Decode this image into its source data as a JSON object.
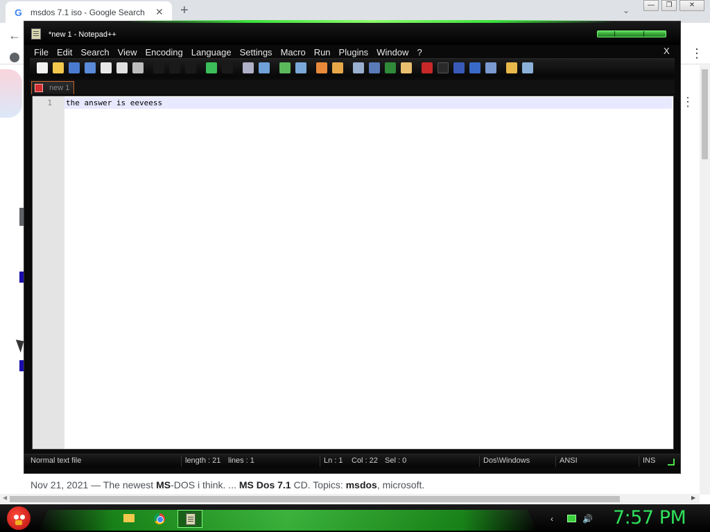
{
  "browser": {
    "tab_title": "msdos 7.1 iso - Google Search",
    "tab_favicon": "G",
    "tab_close": "✕",
    "new_tab": "+",
    "tab_search": "⌄",
    "win_minimize": "—",
    "win_restore": "❐",
    "win_close": "✕",
    "back": "←",
    "menu": "⋮",
    "result_snippet": {
      "date": "Nov 21, 2021 — The newest ",
      "b1": "MS",
      "t1": "-DOS i think. ... ",
      "b2": "MS Dos 7.1",
      "t2": " CD. Topics: ",
      "b3": "msdos",
      "t3": ", microsoft."
    }
  },
  "npp": {
    "title": "*new  1 - Notepad++",
    "menu": [
      "File",
      "Edit",
      "Search",
      "View",
      "Encoding",
      "Language",
      "Settings",
      "Macro",
      "Run",
      "Plugins",
      "Window",
      "?"
    ],
    "close_doc": "X",
    "tab_label": "new  1",
    "line_number": "1",
    "line_text": "the answer is eeveess",
    "status": {
      "file_type": "Normal text file",
      "length": "length : 21",
      "lines": "lines : 1",
      "ln": "Ln : 1",
      "col": "Col : 22",
      "sel": "Sel : 0",
      "eol": "Dos\\Windows",
      "encoding": "ANSI",
      "mode": "INS"
    }
  },
  "taskbar": {
    "clock": "7:57 PM",
    "tray_arrow": "‹",
    "tray_volume": "🔊"
  },
  "colors": {
    "accent_green": "#2ee05a",
    "window_bg": "#0a0a0a",
    "current_line": "#e8e8ff"
  }
}
